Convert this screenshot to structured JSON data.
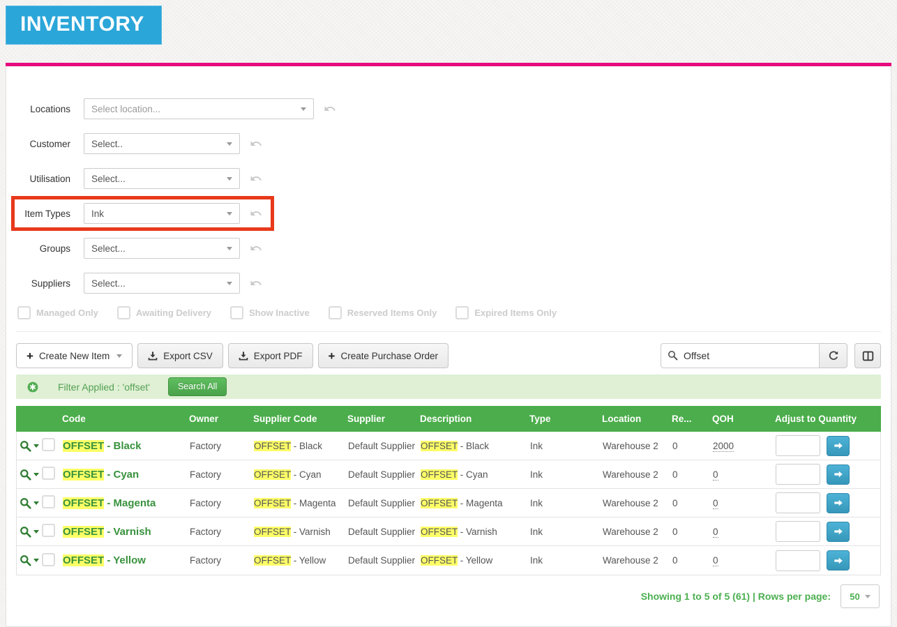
{
  "header": {
    "title": "INVENTORY"
  },
  "filters": {
    "rows": [
      {
        "label": "Locations",
        "value": "Select location..."
      },
      {
        "label": "Customer",
        "value": "Select.."
      },
      {
        "label": "Utilisation",
        "value": "Select..."
      },
      {
        "label": "Item Types",
        "value": "Ink"
      },
      {
        "label": "Groups",
        "value": "Select..."
      },
      {
        "label": "Suppliers",
        "value": "Select..."
      }
    ],
    "checkboxes": [
      {
        "label": "Managed Only",
        "checked": false
      },
      {
        "label": "Awaiting Delivery",
        "checked": false
      },
      {
        "label": "Show Inactive",
        "checked": false
      },
      {
        "label": "Reserved Items Only",
        "checked": false
      },
      {
        "label": "Expired Items Only",
        "checked": false
      }
    ]
  },
  "toolbar": {
    "create_new_item_label": "Create New Item",
    "export_csv_label": "Export CSV",
    "export_pdf_label": "Export PDF",
    "create_purchase_order_label": "Create Purchase Order",
    "search_value": "Offset"
  },
  "banner": {
    "text": "Filter Applied : 'offset'",
    "search_all_label": "Search All"
  },
  "table": {
    "columns": [
      "Code",
      "Owner",
      "Supplier Code",
      "Supplier",
      "Description",
      "Type",
      "Location",
      "Re...",
      "QOH",
      "Adjust to Quantity"
    ],
    "highlight": "OFFSET",
    "rows": [
      {
        "code": " - Black",
        "owner": "Factory",
        "supplier_code": " - Black",
        "supplier": "Default Supplier",
        "description": " - Black",
        "type": "Ink",
        "location": "Warehouse 2",
        "re": "0",
        "qoh": "2000"
      },
      {
        "code": " - Cyan",
        "owner": "Factory",
        "supplier_code": " - Cyan",
        "supplier": "Default Supplier",
        "description": " - Cyan",
        "type": "Ink",
        "location": "Warehouse 2",
        "re": "0",
        "qoh": "0"
      },
      {
        "code": " - Magenta",
        "owner": "Factory",
        "supplier_code": " - Magenta",
        "supplier": "Default Supplier",
        "description": " - Magenta",
        "type": "Ink",
        "location": "Warehouse 2",
        "re": "0",
        "qoh": "0"
      },
      {
        "code": " - Varnish",
        "owner": "Factory",
        "supplier_code": " - Varnish",
        "supplier": "Default Supplier",
        "description": " - Varnish",
        "type": "Ink",
        "location": "Warehouse 2",
        "re": "0",
        "qoh": "0"
      },
      {
        "code": " - Yellow",
        "owner": "Factory",
        "supplier_code": " - Yellow",
        "supplier": "Default Supplier",
        "description": " - Yellow",
        "type": "Ink",
        "location": "Warehouse 2",
        "re": "0",
        "qoh": "0"
      }
    ]
  },
  "footer": {
    "showing": "Showing 1 to 5 of 5 (61) | Rows per page:",
    "rows_per_page": "50"
  },
  "icons": {
    "reset": "undo-arrow",
    "search": "magnifier",
    "refresh": "circular-arrow",
    "columns": "split-rectangle",
    "banner_status": "green-circle-asterisk",
    "export": "download-arrow",
    "adjust": "right-arrow"
  },
  "colors": {
    "brand_blue": "#2ba6d9",
    "accent_pink": "#e50c7e",
    "table_header_green": "#4bad4b",
    "link_green": "#38923d",
    "highlight_yellow": "#fdff67",
    "banner_bg": "#dff0d4",
    "banner_text_green": "#55a055",
    "adjust_button_blue": "#3fa7cb",
    "selected_filter_red": "#e8391b"
  }
}
